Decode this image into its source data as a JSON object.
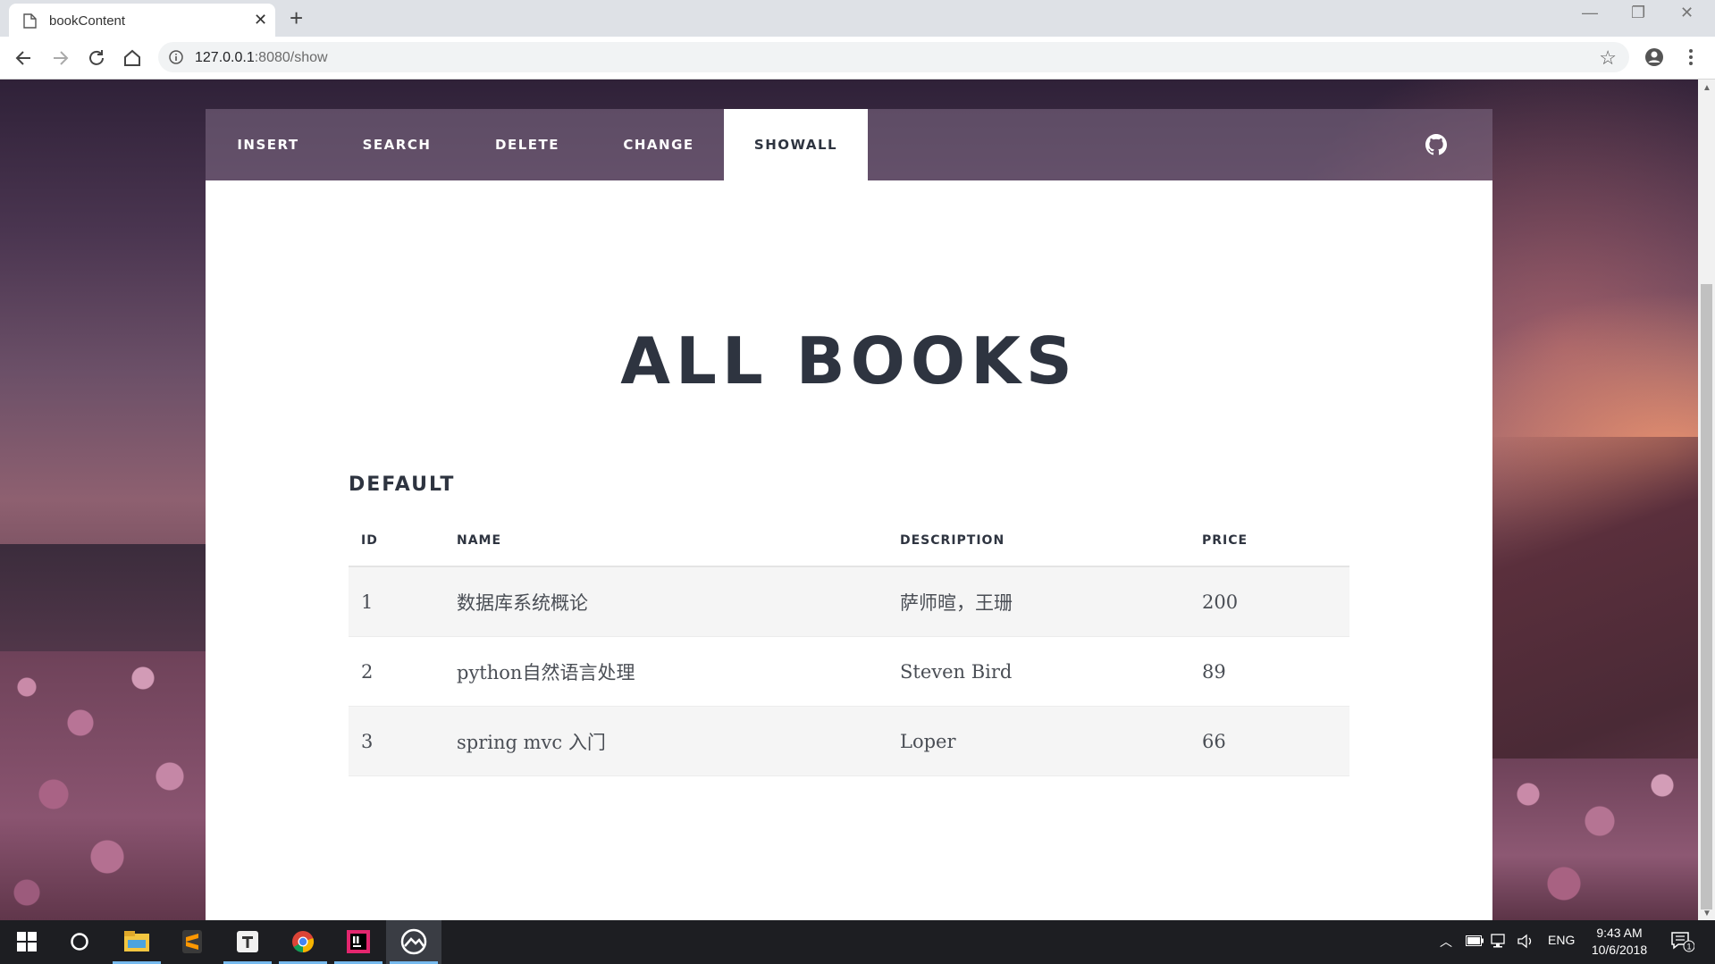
{
  "browser": {
    "tab_title": "bookContent",
    "tab_close": "✕",
    "new_tab": "+",
    "url_host": "127.0.0.1",
    "url_rest": ":8080/show",
    "window_controls": {
      "minimize": "—",
      "restore": "❐",
      "close": "✕"
    }
  },
  "nav": {
    "items": [
      {
        "label": "INSERT"
      },
      {
        "label": "SEARCH"
      },
      {
        "label": "DELETE"
      },
      {
        "label": "CHANGE"
      },
      {
        "label": "SHOWALL"
      }
    ],
    "active": "SHOWALL",
    "github_icon": "github-icon"
  },
  "main": {
    "title": "ALL BOOKS",
    "section": "DEFAULT",
    "columns": [
      "ID",
      "NAME",
      "DESCRIPTION",
      "PRICE"
    ],
    "rows": [
      {
        "id": "1",
        "name": "数据库系统概论",
        "description": "萨师暄，王珊",
        "price": "200"
      },
      {
        "id": "2",
        "name": "python自然语言处理",
        "description": "Steven Bird",
        "price": "89"
      },
      {
        "id": "3",
        "name": "spring mvc 入门",
        "description": "Loper",
        "price": "66"
      }
    ]
  },
  "taskbar": {
    "language": "ENG",
    "time": "9:43 AM",
    "date": "10/6/2018",
    "notification_count": "1",
    "apps": [
      "windows-start-icon",
      "cortana-icon",
      "file-explorer-icon",
      "sublime-text-icon",
      "typora-icon",
      "chrome-icon",
      "intellij-icon",
      "app-icon"
    ]
  },
  "colors": {
    "accent": "#2e3440",
    "nav_overlay": "#826e87",
    "taskbar": "#1d1e22"
  }
}
